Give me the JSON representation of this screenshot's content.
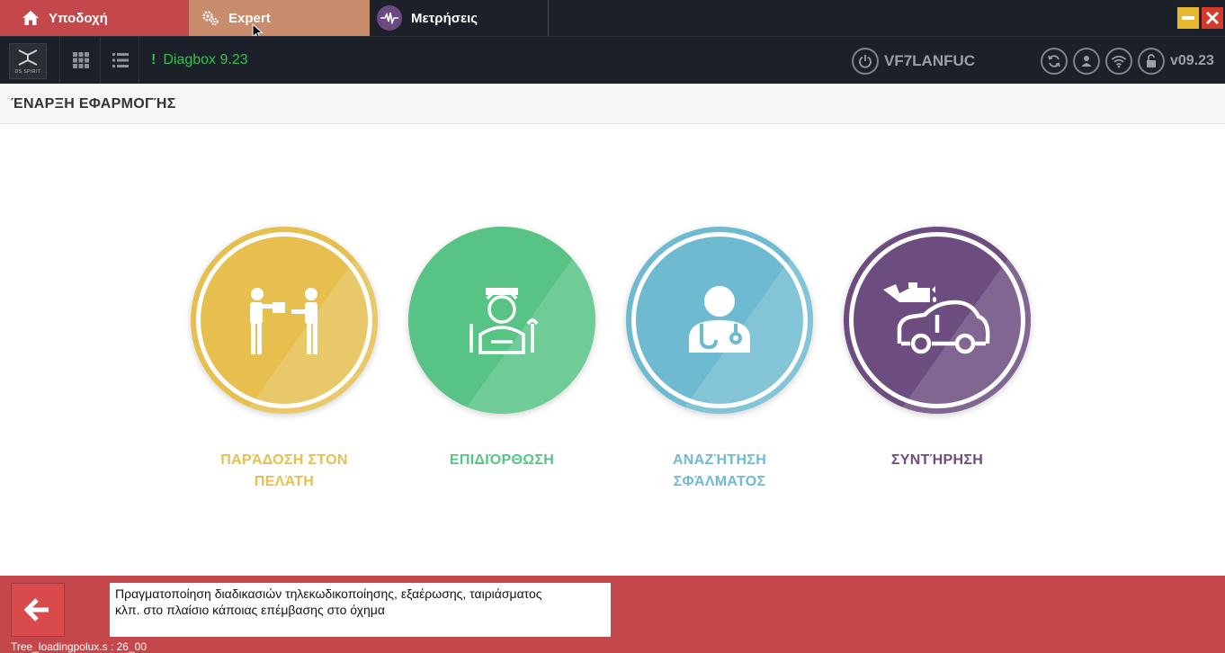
{
  "tabs": [
    {
      "label": "Υποδοχή",
      "icon": "home-icon"
    },
    {
      "label": "Expert",
      "icon": "gears-icon"
    },
    {
      "label": "Μετρήσεις",
      "icon": "pulse-icon"
    }
  ],
  "toolbar": {
    "logo_text": "DS SPIRIT",
    "diag_mark": "!",
    "diag_label": "Diagbox 9.23",
    "vin": "VF7LANFUC",
    "version": "v09.23"
  },
  "page": {
    "title": "ΈΝΑΡΞΗ ΕΦΑΡΜΟΓΉΣ"
  },
  "cards": [
    {
      "label_line1": "ΠΑΡΆΔΟΣΗ ΣΤΟΝ",
      "label_line2": "ΠΕΛΆΤΗ",
      "color": "#e6bf4f"
    },
    {
      "label_line1": "ΕΠΙΔΙΌΡΘΩΣΗ",
      "label_line2": "",
      "color": "#57c485"
    },
    {
      "label_line1": "ΑΝΑΖΉΤΗΣΗ",
      "label_line2": "ΣΦΆΛΜΑΤΟΣ",
      "color": "#6ebbd1"
    },
    {
      "label_line1": "ΣΥΝΤΉΡΗΣΗ",
      "label_line2": "",
      "color": "#6d4c7f"
    }
  ],
  "bottom": {
    "info_line1": "Πραγματοποίηση διαδικασιών τηλεκωδικοποίησης, εξαέρωσης, ταιριάσματος",
    "info_line2": "κλπ. στο πλαίσιο κάποιας επέμβασης στο όχημα",
    "status": "Tree_loadingpolux.s : 26_00"
  },
  "colors": {
    "tab_home": "#c4484b",
    "tab_expert": "#c88b6c",
    "dark_bar": "#1c2129",
    "bottom_bar": "#c4484b",
    "diag_green": "#33c24d"
  }
}
